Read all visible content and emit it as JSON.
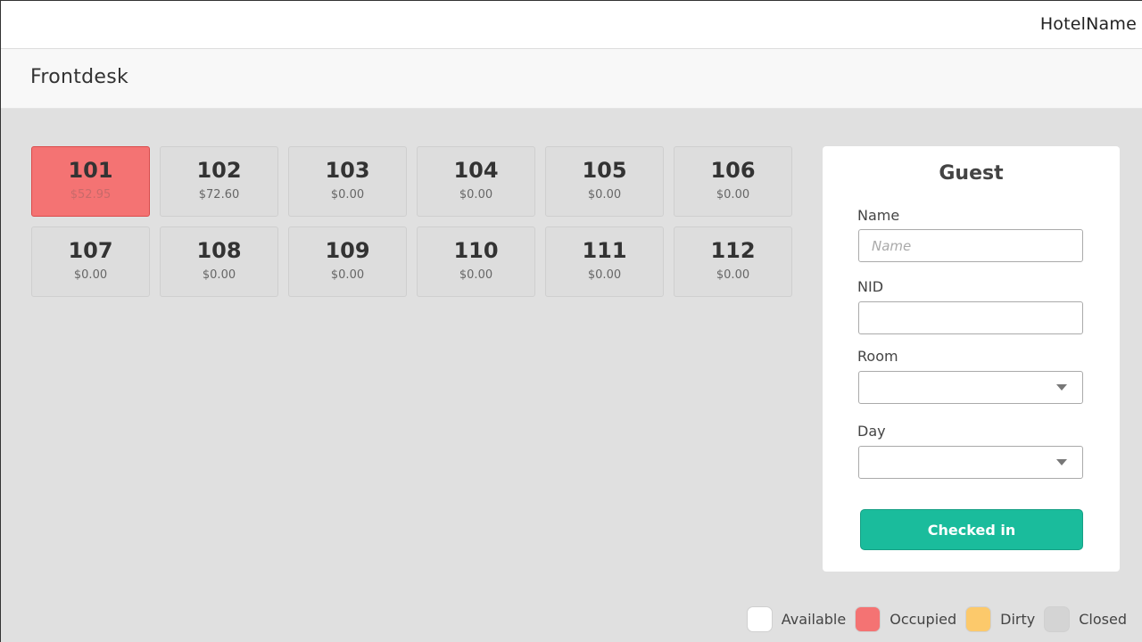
{
  "header": {
    "hotel_name": "HotelName"
  },
  "page": {
    "title": "Frontdesk"
  },
  "rooms": [
    {
      "number": "101",
      "price": "$52.95",
      "status": "occupied"
    },
    {
      "number": "102",
      "price": "$72.60",
      "status": "closed"
    },
    {
      "number": "103",
      "price": "$0.00",
      "status": "closed"
    },
    {
      "number": "104",
      "price": "$0.00",
      "status": "closed"
    },
    {
      "number": "105",
      "price": "$0.00",
      "status": "closed"
    },
    {
      "number": "106",
      "price": "$0.00",
      "status": "closed"
    },
    {
      "number": "107",
      "price": "$0.00",
      "status": "closed"
    },
    {
      "number": "108",
      "price": "$0.00",
      "status": "closed"
    },
    {
      "number": "109",
      "price": "$0.00",
      "status": "closed"
    },
    {
      "number": "110",
      "price": "$0.00",
      "status": "closed"
    },
    {
      "number": "111",
      "price": "$0.00",
      "status": "closed"
    },
    {
      "number": "112",
      "price": "$0.00",
      "status": "closed"
    }
  ],
  "guest_form": {
    "title": "Guest",
    "name": {
      "label": "Name",
      "placeholder": "Name",
      "value": ""
    },
    "nid": {
      "label": "NID",
      "value": ""
    },
    "room": {
      "label": "Room",
      "value": ""
    },
    "day": {
      "label": "Day",
      "value": ""
    },
    "submit_label": "Checked in"
  },
  "legend": [
    {
      "label": "Available",
      "color": "#ffffff"
    },
    {
      "label": "Occupied",
      "color": "#f47373"
    },
    {
      "label": "Dirty",
      "color": "#fcc96b"
    },
    {
      "label": "Closed",
      "color": "#d4d4d4"
    }
  ],
  "colors": {
    "accent": "#1abc9c",
    "occupied": "#f47373",
    "closed": "#dddddd"
  }
}
